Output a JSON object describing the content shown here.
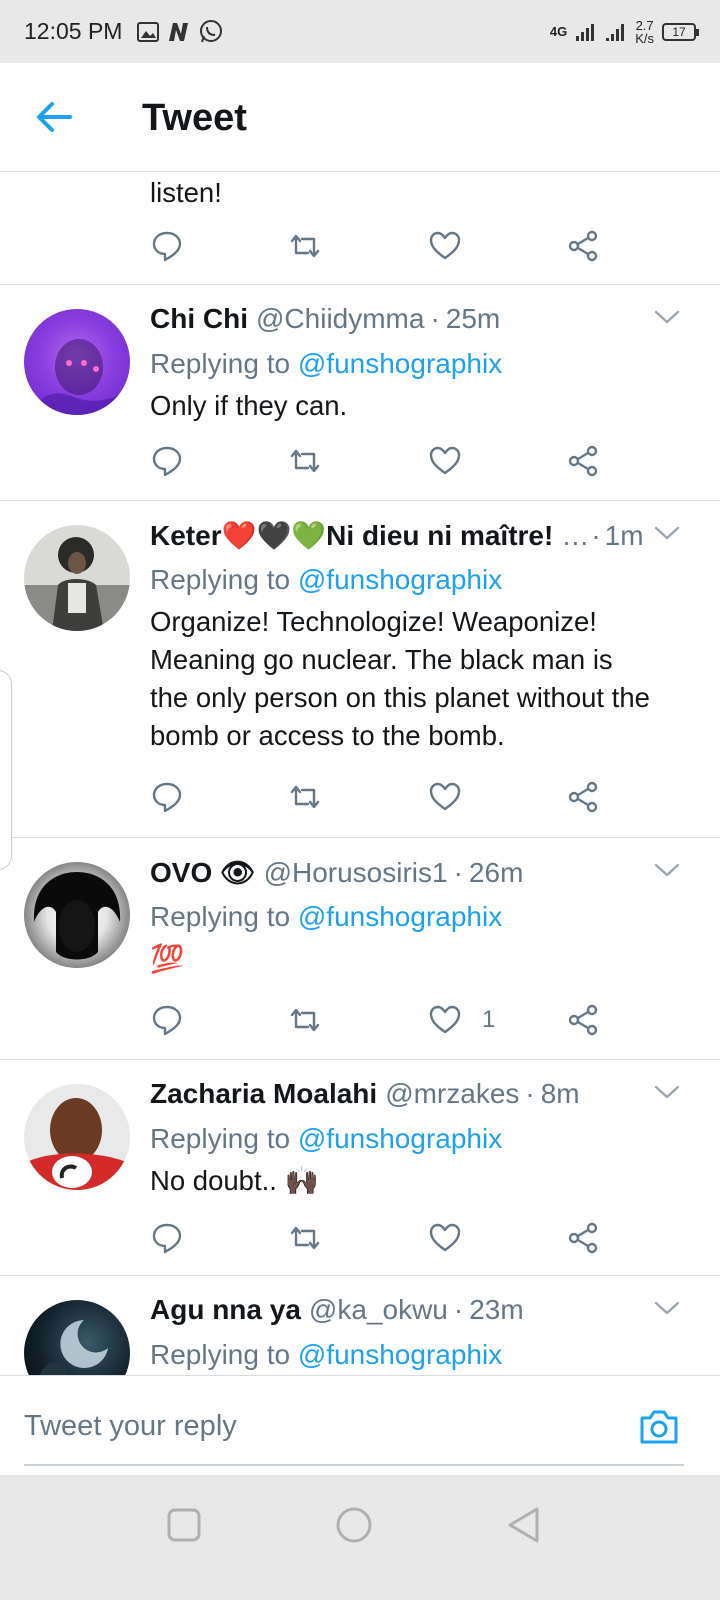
{
  "status_bar": {
    "time": "12:05 PM",
    "network": "4G",
    "speed_value": "2.7",
    "speed_unit": "K/s",
    "battery": "17"
  },
  "header": {
    "title": "Tweet",
    "back_icon": "arrow-left-icon"
  },
  "partial_tweet": {
    "text": "listen!"
  },
  "tweets": [
    {
      "name": "Chi Chi",
      "handle": "@Chiidymma",
      "time": "25m",
      "replying_prefix": "Replying to",
      "replying_to": "@funshographix",
      "text": "Only if they can.",
      "likes": ""
    },
    {
      "name": "Keter❤️🖤💚Ni dieu ni maître!",
      "handle": "…",
      "time": "1m",
      "replying_prefix": "Replying to",
      "replying_to": "@funshographix",
      "text": "Organize! Technologize! Weaponize! Meaning go nuclear. The black man is the only person on this planet without the bomb or access to the bomb.",
      "likes": ""
    },
    {
      "name": "OVO 👁",
      "handle": "@Horusosiris1",
      "time": "26m",
      "replying_prefix": "Replying to",
      "replying_to": "@funshographix",
      "text": "💯",
      "likes": "1"
    },
    {
      "name": "Zacharia Moalahi",
      "handle": "@mrzakes",
      "time": "8m",
      "replying_prefix": "Replying to",
      "replying_to": "@funshographix",
      "text": "No doubt.. 🙌🏿",
      "likes": ""
    },
    {
      "name": "Agu nna ya",
      "handle": "@ka_okwu",
      "time": "23m",
      "replying_prefix": "Replying to",
      "replying_to": "@funshographix",
      "text": "",
      "likes": ""
    }
  ],
  "reply_bar": {
    "placeholder": "Tweet your reply",
    "camera_icon": "camera-icon"
  },
  "colors": {
    "accent": "#1da1f2",
    "secondary_text": "#657786",
    "divider": "#d9dde1"
  }
}
